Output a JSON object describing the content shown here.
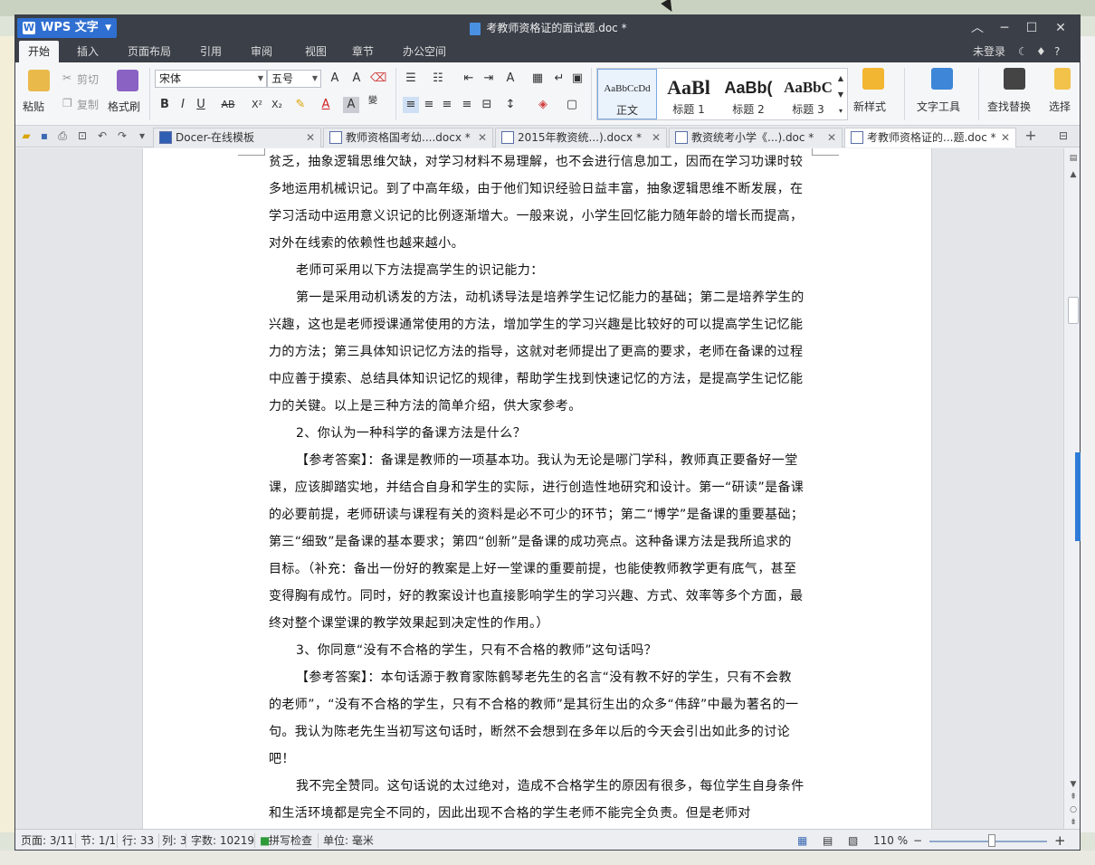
{
  "window": {
    "app_name": "WPS 文字",
    "doc_title": "考教师资格证的面试题.doc *"
  },
  "menu": {
    "items": [
      "开始",
      "插入",
      "页面布局",
      "引用",
      "审阅",
      "视图",
      "章节",
      "办公空间"
    ],
    "active": "开始",
    "login": "未登录",
    "help": "?"
  },
  "ribbon": {
    "paste": "粘贴",
    "cut": "剪切",
    "copy": "复制",
    "format_painter": "格式刷",
    "font_name": "宋体",
    "font_size": "五号",
    "styles": [
      {
        "sample": "AaBbCcDd",
        "label": "正文"
      },
      {
        "sample": "AaBl",
        "label": "标题 1"
      },
      {
        "sample": "AaBb(",
        "label": "标题 2"
      },
      {
        "sample": "AaBbC",
        "label": "标题 3"
      }
    ],
    "new_style": "新样式",
    "text_tools": "文字工具",
    "find_replace": "查找替换",
    "select": "选择"
  },
  "tabs": [
    {
      "label": "Docer-在线模板",
      "active": false
    },
    {
      "label": "教师资格国考幼....docx *",
      "active": false
    },
    {
      "label": "2015年教资统...).docx *",
      "active": false
    },
    {
      "label": "教资统考小学《...).doc *",
      "active": false
    },
    {
      "label": "考教师资格证的...题.doc *",
      "active": true
    }
  ],
  "document": {
    "paragraphs": [
      {
        "indent": false,
        "text": "贫乏，抽象逻辑思维欠缺，对学习材料不易理解，也不会进行信息加工，因而在学习功课时较多地运用机械识记。到了中高年级，由于他们知识经验日益丰富，抽象逻辑思维不断发展，在学习活动中运用意义识记的比例逐渐增大。一般来说，小学生回忆能力随年龄的增长而提高，对外在线索的依赖性也越来越小。"
      },
      {
        "indent": true,
        "text": "老师可采用以下方法提高学生的识记能力："
      },
      {
        "indent": true,
        "text": "第一是采用动机诱发的方法，动机诱导法是培养学生记忆能力的基础；第二是培养学生的兴趣，这也是老师授课通常使用的方法，增加学生的学习兴趣是比较好的可以提高学生记忆能力的方法；第三具体知识记忆方法的指导，这就对老师提出了更高的要求，老师在备课的过程中应善于摸索、总结具体知识记忆的规律，帮助学生找到快速记忆的方法，是提高学生记忆能力的关键。以上是三种方法的简单介绍，供大家参考。"
      },
      {
        "indent": true,
        "text": "2、你认为一种科学的备课方法是什么？"
      },
      {
        "indent": true,
        "text": "【参考答案】：备课是教师的一项基本功。我认为无论是哪门学科，教师真正要备好一堂课，应该脚踏实地，并结合自身和学生的实际，进行创造性地研究和设计。第一“研读”是备课的必要前提，老师研读与课程有关的资料是必不可少的环节；第二“博学”是备课的重要基础；第三“细致”是备课的基本要求；第四“创新”是备课的成功亮点。这种备课方法是我所追求的目标。（补充：备出一份好的教案是上好一堂课的重要前提，也能使教师教学更有底气，甚至变得胸有成竹。同时，好的教案设计也直接影响学生的学习兴趣、方式、效率等多个方面，最终对整个课堂课的教学效果起到决定性的作用。）"
      },
      {
        "indent": true,
        "text": "3、你同意“没有不合格的学生，只有不合格的教师”这句话吗？"
      },
      {
        "indent": true,
        "text": "【参考答案】：本句话源于教育家陈鹤琴老先生的名言“没有教不好的学生，只有不会教的老师”，“没有不合格的学生，只有不合格的教师”是其衍生出的众多“伟辞”中最为著名的一句。我认为陈老先生当初写这句话时，断然不会想到在多年以后的今天会引出如此多的讨论吧！"
      },
      {
        "indent": true,
        "text": "我不完全赞同。这句话说的太过绝对，造成不合格学生的原因有很多，每位学生自身条件和生活环境都是完全不同的，因此出现不合格的学生老师不能完全负责。但是老师对"
      }
    ]
  },
  "status": {
    "page": "页面: 3/11",
    "section": "节: 1/1",
    "row": "行: 33",
    "col": "列: 3",
    "words": "字数: 10219",
    "spell": "拼写检查",
    "unit": "单位: 毫米",
    "zoom": "110 %"
  }
}
